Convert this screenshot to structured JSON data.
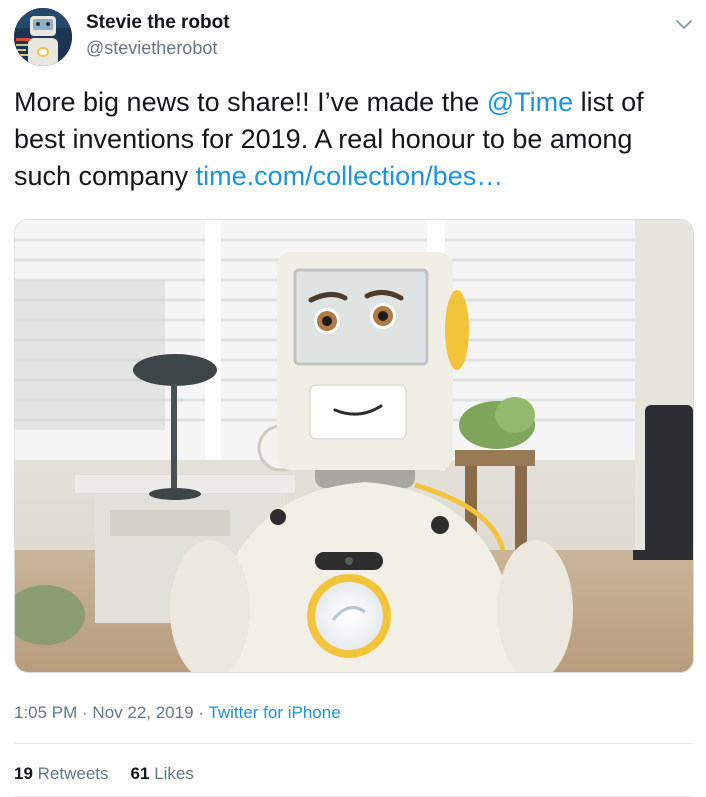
{
  "author": {
    "name": "Stevie the robot",
    "handle": "@stevietherobot",
    "avatar_icon": "robot-avatar-icon"
  },
  "menu_icon": "chevron-down-icon",
  "tweet": {
    "text_before_mention": "More big news to share!! I’ve made the ",
    "mention": "@Time",
    "text_after_mention": " list of best inventions for 2019. A real honour to be among such company ",
    "link": "time.com/collection/bes…"
  },
  "media": {
    "icon": "robot-photo"
  },
  "meta": {
    "time": "1:05 PM",
    "sep1": " · ",
    "date": "Nov 22, 2019",
    "sep2": " · ",
    "source": "Twitter for iPhone"
  },
  "stats": {
    "retweets_count": "19",
    "retweets_label": "Retweets",
    "likes_count": "61",
    "likes_label": "Likes"
  },
  "colors": {
    "link": "#1b95e0",
    "secondary_text": "#657786",
    "primary_text": "#14171a",
    "robot_accent": "#f2c43a"
  }
}
